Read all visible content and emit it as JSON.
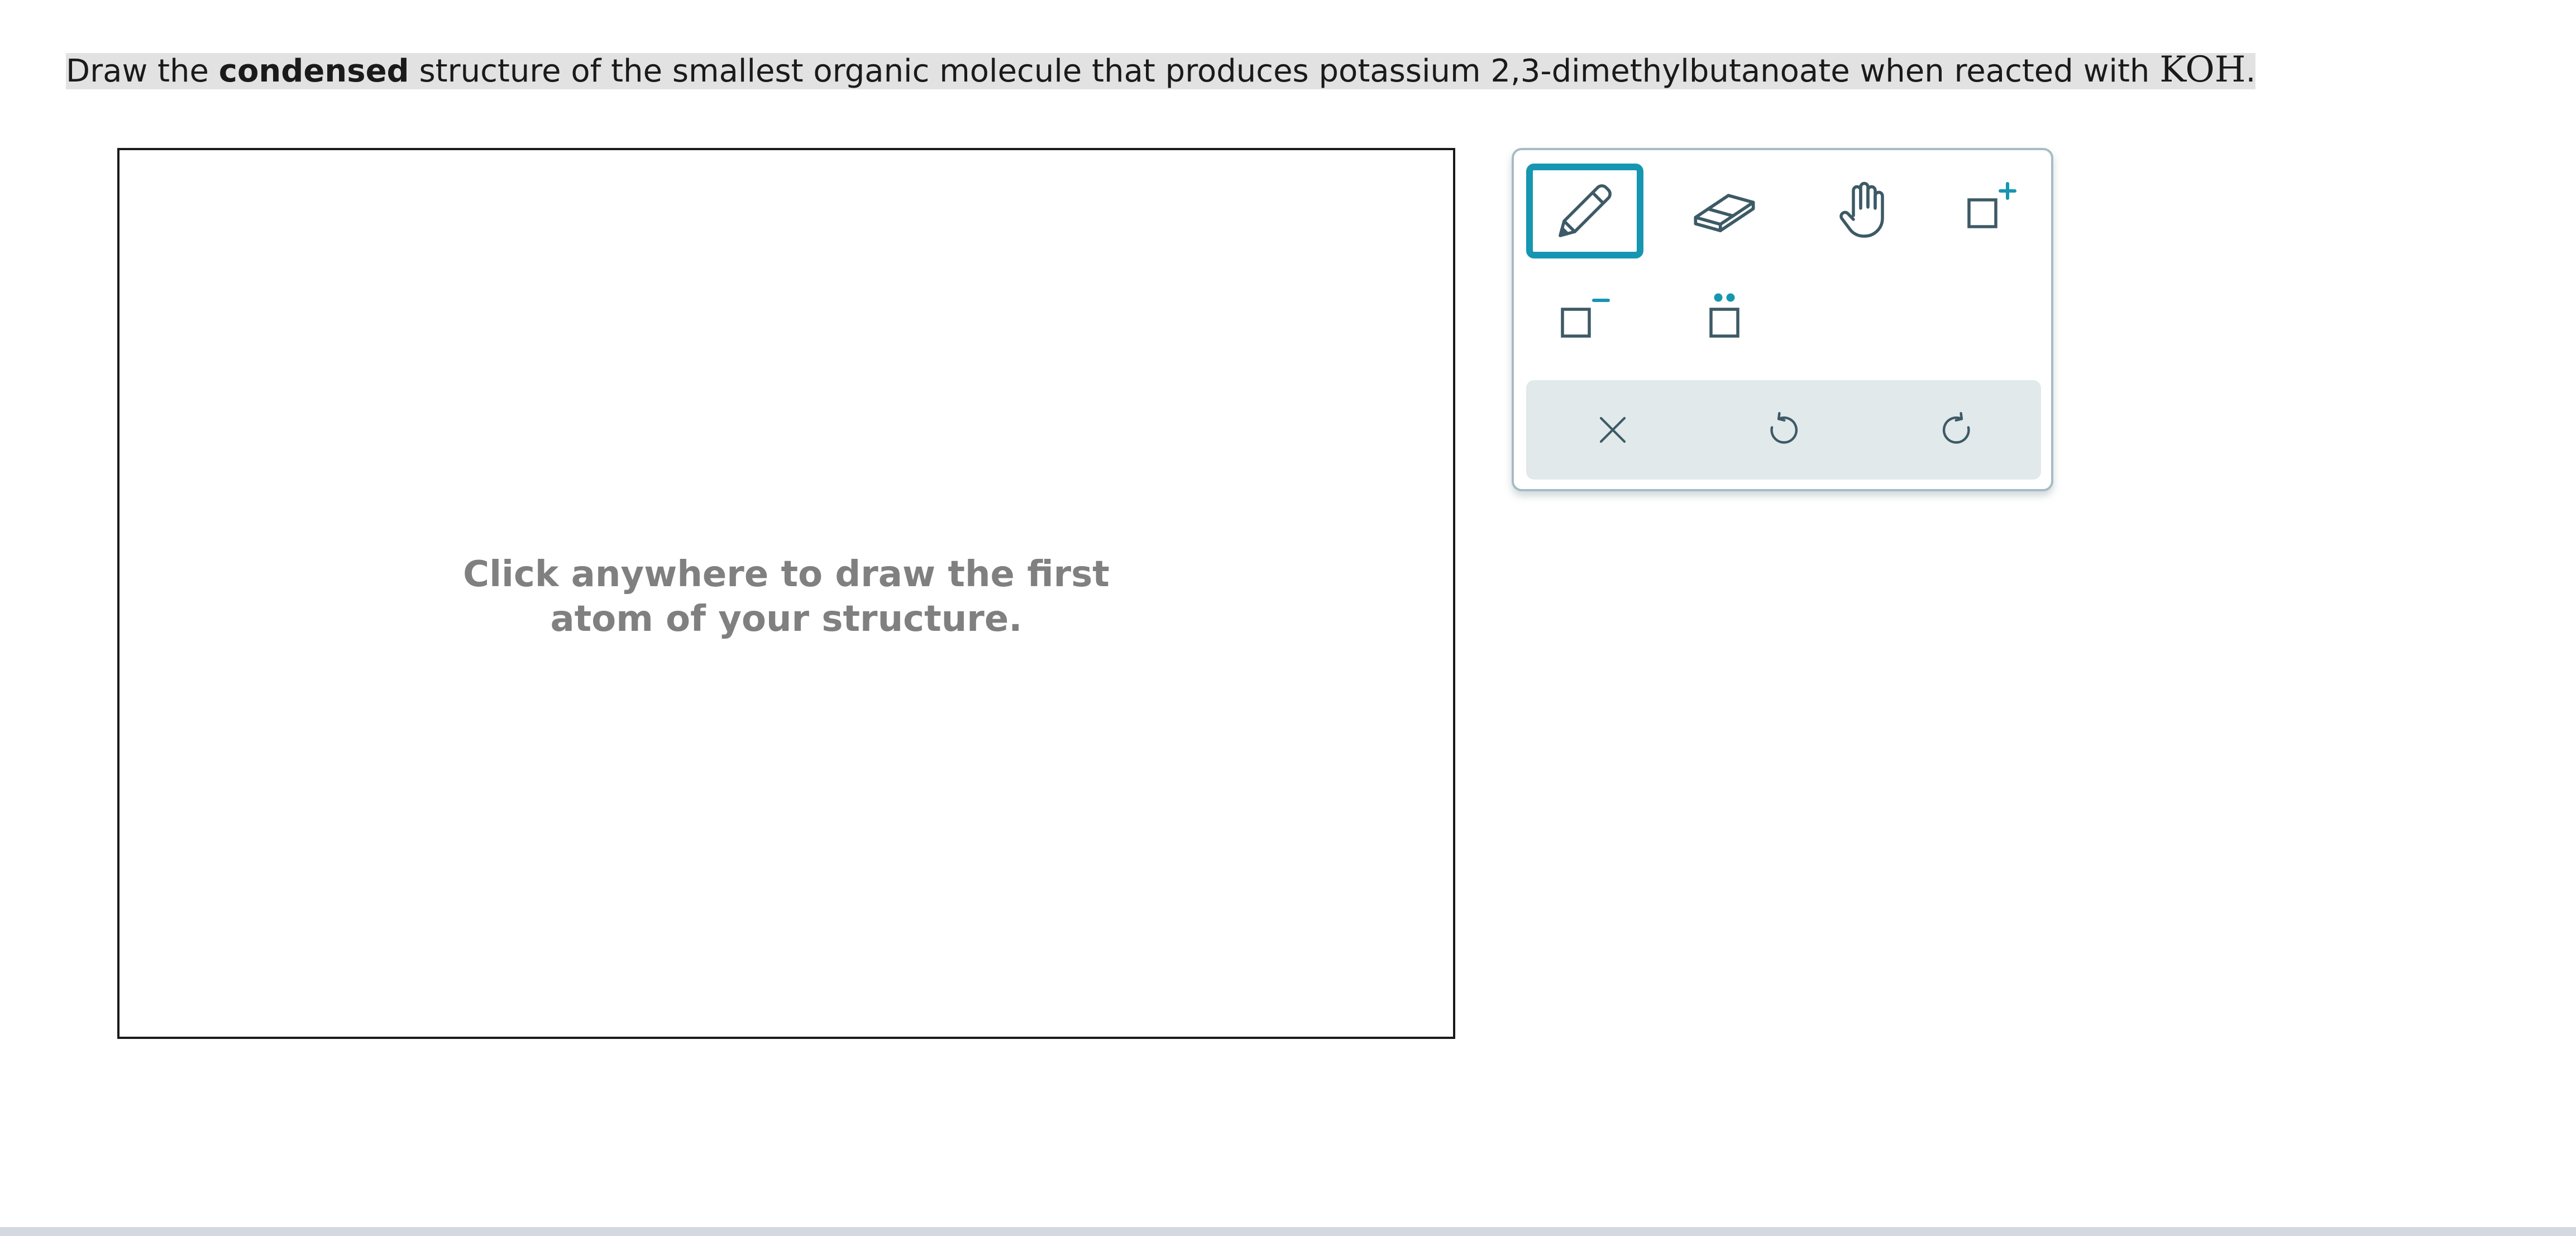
{
  "question": {
    "part1": "Draw the ",
    "bold": "condensed",
    "part2": " structure of the smallest organic molecule that produces potassium 2,3-dimethylbutanoate when reacted with ",
    "formula": "KOH",
    "period": "."
  },
  "canvas": {
    "hint_line1": "Click anywhere to draw the first",
    "hint_line2": "atom of your structure."
  },
  "toolbar": {
    "tools": [
      {
        "name": "pencil",
        "icon": "pencil-icon",
        "active": true
      },
      {
        "name": "eraser",
        "icon": "eraser-icon",
        "active": false
      },
      {
        "name": "hand",
        "icon": "hand-icon",
        "active": false
      },
      {
        "name": "positive-charge",
        "icon": "positive-charge-icon",
        "active": false
      },
      {
        "name": "negative-charge",
        "icon": "negative-charge-icon",
        "active": false
      },
      {
        "name": "lone-pair",
        "icon": "lone-pair-icon",
        "active": false
      }
    ],
    "actions": [
      {
        "name": "clear",
        "icon": "close-icon"
      },
      {
        "name": "undo",
        "icon": "undo-icon"
      },
      {
        "name": "redo",
        "icon": "redo-icon"
      }
    ]
  },
  "colors": {
    "accent": "#1696b0",
    "icon": "#3d5a66",
    "text": "#1a1a1a",
    "hint": "#808080",
    "highlight": "#e2e2e2",
    "action_bar": "#e2e9eb"
  }
}
